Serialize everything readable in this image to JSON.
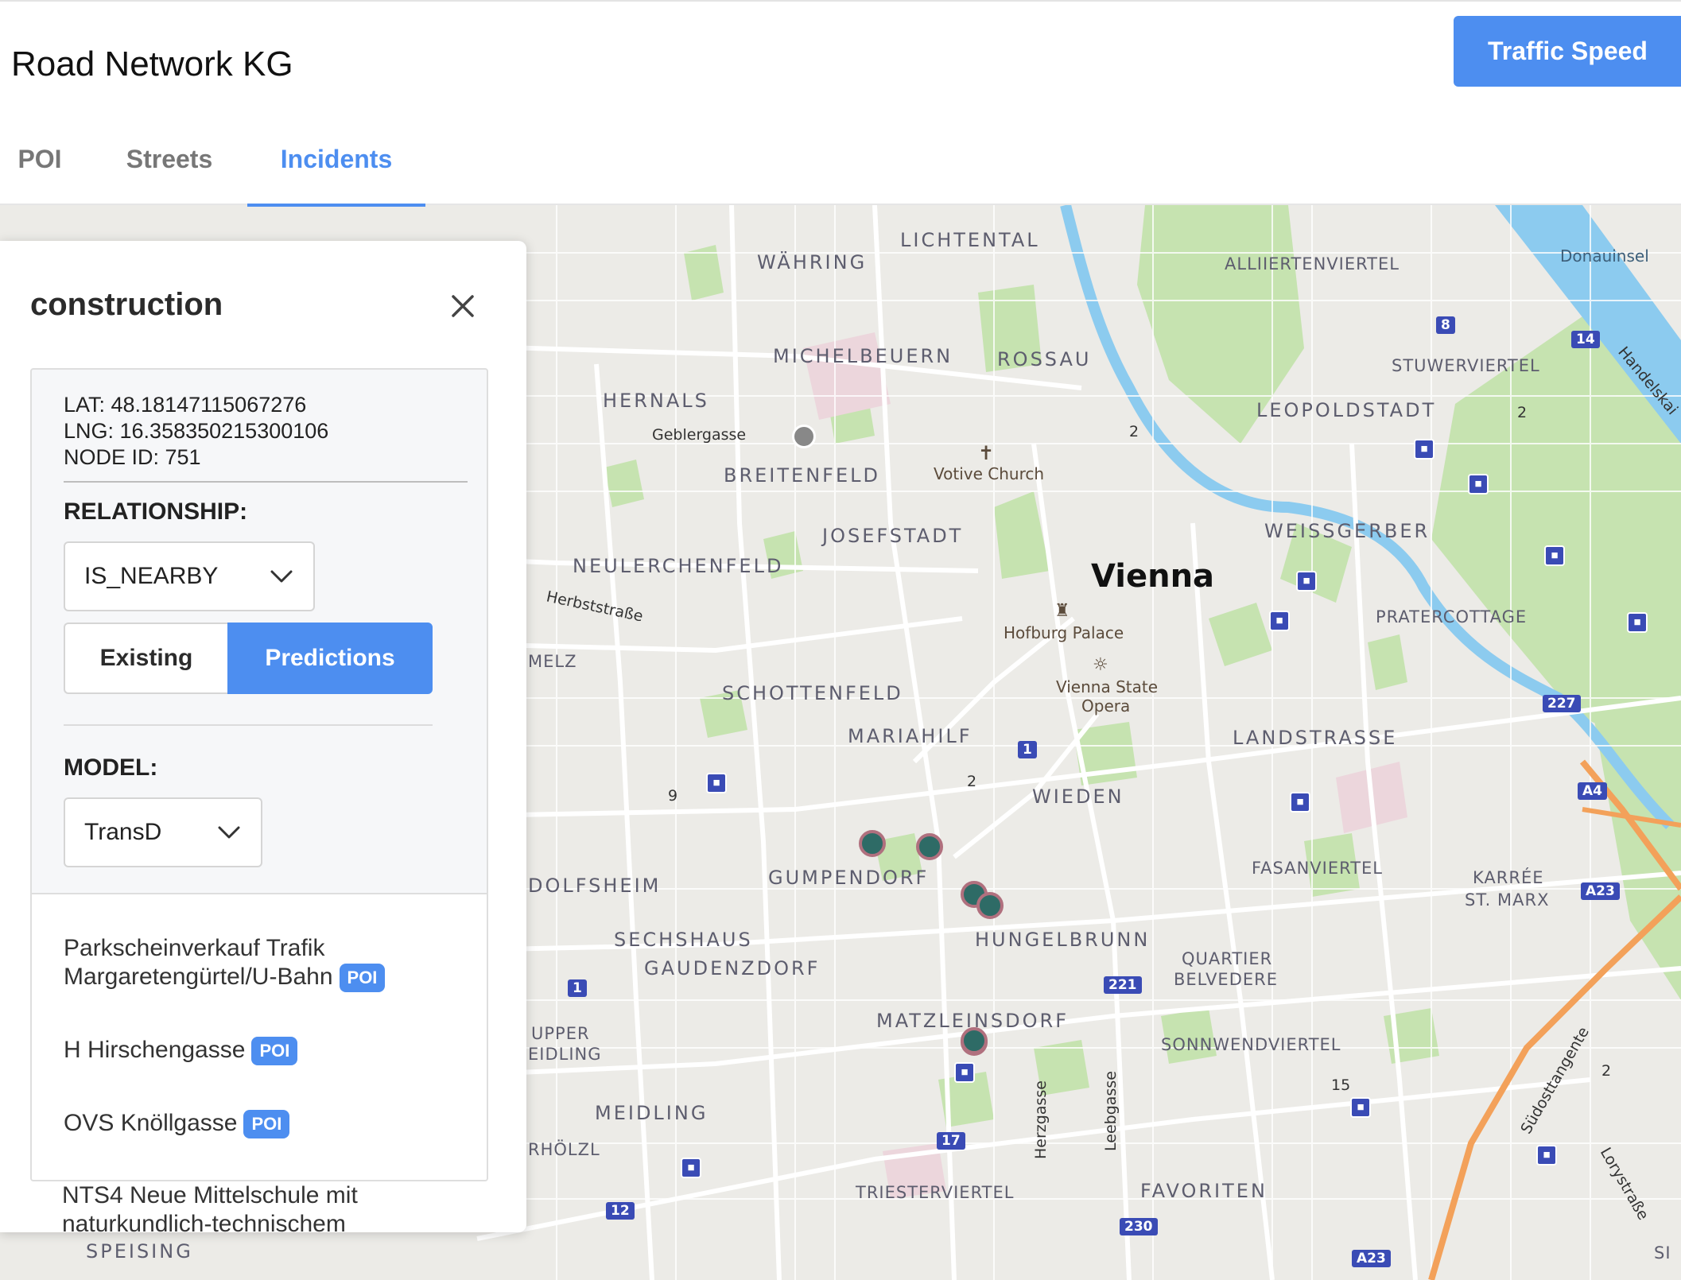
{
  "app": {
    "title": "Road Network KG",
    "traffic_button": "Traffic Speed"
  },
  "tabs": [
    {
      "label": "POI"
    },
    {
      "label": "Streets"
    },
    {
      "label": "Incidents"
    }
  ],
  "colors": {
    "accent": "#4d8ef0",
    "marker_fill": "#2e6b66",
    "marker_ring": "#b0707e",
    "water": "#8ccbef",
    "park": "#c6e3b0"
  },
  "panel": {
    "title": "construction",
    "lat": "LAT: 48.18147115067276",
    "lng": "LNG: 16.358350215300106",
    "node_id": "NODE ID: 751",
    "relationship_label": "RELATIONSHIP:",
    "relationship_value": "IS_NEARBY",
    "toggle_existing": "Existing",
    "toggle_predictions": "Predictions",
    "model_label": "MODEL:",
    "model_value": "TransD",
    "poi_badge": "POI",
    "pois": [
      {
        "line1": "Parkscheinverkauf Trafik",
        "line2": "Margaretengürtel/U-Bahn"
      },
      {
        "line1": "H Hirschengasse",
        "line2": ""
      },
      {
        "line1": "OVS Knöllgasse",
        "line2": ""
      }
    ],
    "overflow_item": "NTS4 Neue Mittelschule mit naturkundlich-technischem"
  },
  "map": {
    "city": "Vienna",
    "districts": [
      "LICHTENTAL",
      "WÄHRING",
      "ALLIIERTENVIERTEL",
      "MICHELBEUERN",
      "ROSSAU",
      "STUWERVIERTEL",
      "HERNALS",
      "LEOPOLDSTADT",
      "BREITENFELD",
      "JOSEFSTADT",
      "WEISSGERBER",
      "NEULERCHENFELD",
      "PRATERCOTTAGE",
      "SCHOTTENFELD",
      "MARIAHILF",
      "LANDSTRASSE",
      "WIEDEN",
      "GUMPENDORF",
      "FASANVIERTEL",
      "KARRÉE",
      "ST. MARX",
      "SECHSHAUS",
      "HUNGELBRUNN",
      "QUARTIER",
      "BELVEDERE",
      "GAUDENZDORF",
      "MATZLEINSDORF",
      "SONNWENDVIERTEL",
      "MEIDLING",
      "TRIESTERVIERTEL",
      "FAVORITEN",
      "SPEISING",
      "MELZ",
      "DOLFSHEIM",
      "UPPER",
      "EIDLING",
      "RHÖLZL",
      "SI"
    ],
    "landmarks": [
      "Votive Church",
      "Hofburg Palace",
      "Vienna State",
      "Opera"
    ],
    "streets": [
      "Geblergasse",
      "Herbststraße",
      "Handelskai",
      "Südosttangente",
      "Herzgasse",
      "Leebgasse",
      "Lorystraße"
    ],
    "water": [
      "Donauinsel"
    ],
    "shields": [
      "8",
      "14",
      "227",
      "A4",
      "A23",
      "1",
      "221",
      "1",
      "17",
      "12",
      "230",
      "A23"
    ],
    "road_numbers": [
      "2",
      "2",
      "2",
      "9",
      "15",
      "2"
    ]
  }
}
